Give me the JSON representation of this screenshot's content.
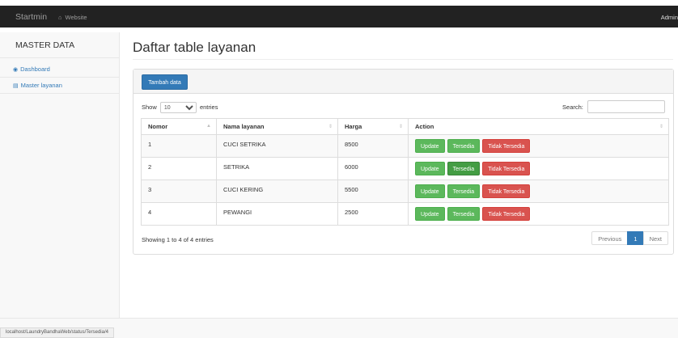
{
  "navbar": {
    "brand": "Startmin",
    "website_label": "Website",
    "website_icon": "home-icon",
    "user_label": "Admin"
  },
  "sidebar": {
    "title": "MASTER DATA",
    "items": [
      {
        "label": "Dashboard",
        "icon": "dashboard-icon"
      },
      {
        "label": "Master layanan",
        "icon": "bar-chart-icon"
      }
    ]
  },
  "main": {
    "title": "Daftar table layanan",
    "add_button": "Tambah data",
    "show_label": "Show",
    "entries_value": "10",
    "entries_label": "entries",
    "search_label": "Search:",
    "search_value": "",
    "columns": [
      "Nomor",
      "Nama layanan",
      "Harga",
      "Action"
    ],
    "rows": [
      {
        "no": "1",
        "name": "CUCI SETRIKA",
        "price": "8500"
      },
      {
        "no": "2",
        "name": "SETRIKA",
        "price": "6000"
      },
      {
        "no": "3",
        "name": "CUCI KERING",
        "price": "5500"
      },
      {
        "no": "4",
        "name": "PEWANGI",
        "price": "2500"
      }
    ],
    "action_labels": {
      "update": "Update",
      "available": "Tersedia",
      "unavailable": "Tidak Tersedia"
    },
    "info": "Showing 1 to 4 of 4 entries",
    "pager": {
      "previous": "Previous",
      "page": "1",
      "next": "Next"
    }
  },
  "statusbar": {
    "url": "localhost/LaundryBandhaWeb/status/Tersedia/4"
  },
  "colors": {
    "navbar": "#222222",
    "primary": "#337ab7",
    "success": "#5cb85c",
    "danger": "#d9534f"
  }
}
